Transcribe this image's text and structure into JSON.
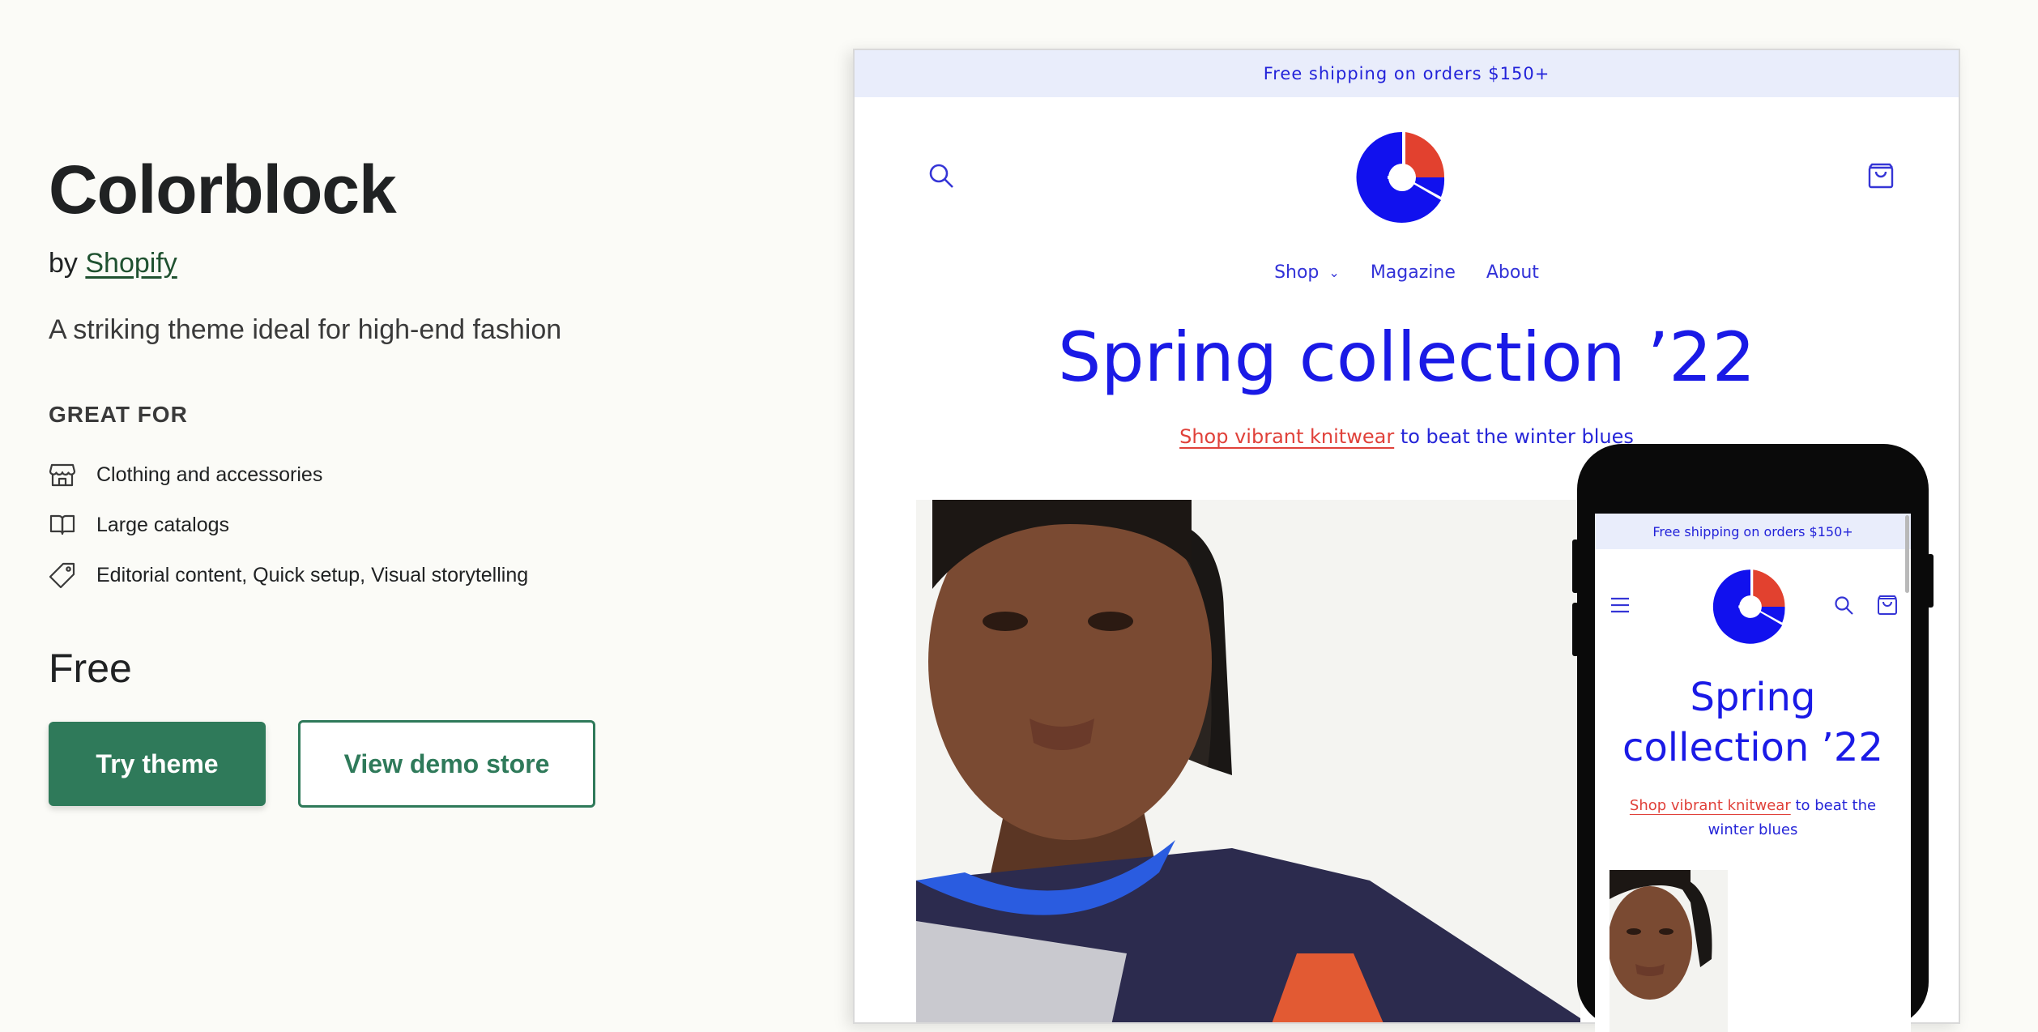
{
  "theme": {
    "title": "Colorblock",
    "by_prefix": "by",
    "author": "Shopify",
    "tagline": "A striking theme ideal for high-end fashion",
    "great_for_heading": "GREAT FOR",
    "features": [
      {
        "label": "Clothing and accessories",
        "icon": "storefront-icon"
      },
      {
        "label": "Large catalogs",
        "icon": "open-book-icon"
      },
      {
        "label": "Editorial content, Quick setup, Visual storytelling",
        "icon": "tag-icon"
      }
    ],
    "price": "Free",
    "try_button": "Try theme",
    "demo_button": "View demo store",
    "accent_color": "#2f7a5a"
  },
  "desktop_preview": {
    "announcement": "Free shipping on orders $150+",
    "nav": {
      "shop": "Shop",
      "magazine": "Magazine",
      "about": "About"
    },
    "headline": "Spring collection ’22",
    "sub_link": "Shop vibrant knitwear",
    "sub_rest": " to beat the winter blues",
    "brand_blue": "#1a1ae6",
    "brand_red": "#e0413a",
    "icons": [
      "search-icon",
      "cart-icon",
      "logo-mark"
    ]
  },
  "mobile_preview": {
    "announcement": "Free shipping on orders $150+",
    "headline_line1": "Spring",
    "headline_line2": "collection ’22",
    "sub_link": "Shop vibrant knitwear",
    "sub_rest": " to beat the winter blues",
    "icons": [
      "menu-icon",
      "logo-mark",
      "search-icon",
      "cart-icon"
    ]
  }
}
